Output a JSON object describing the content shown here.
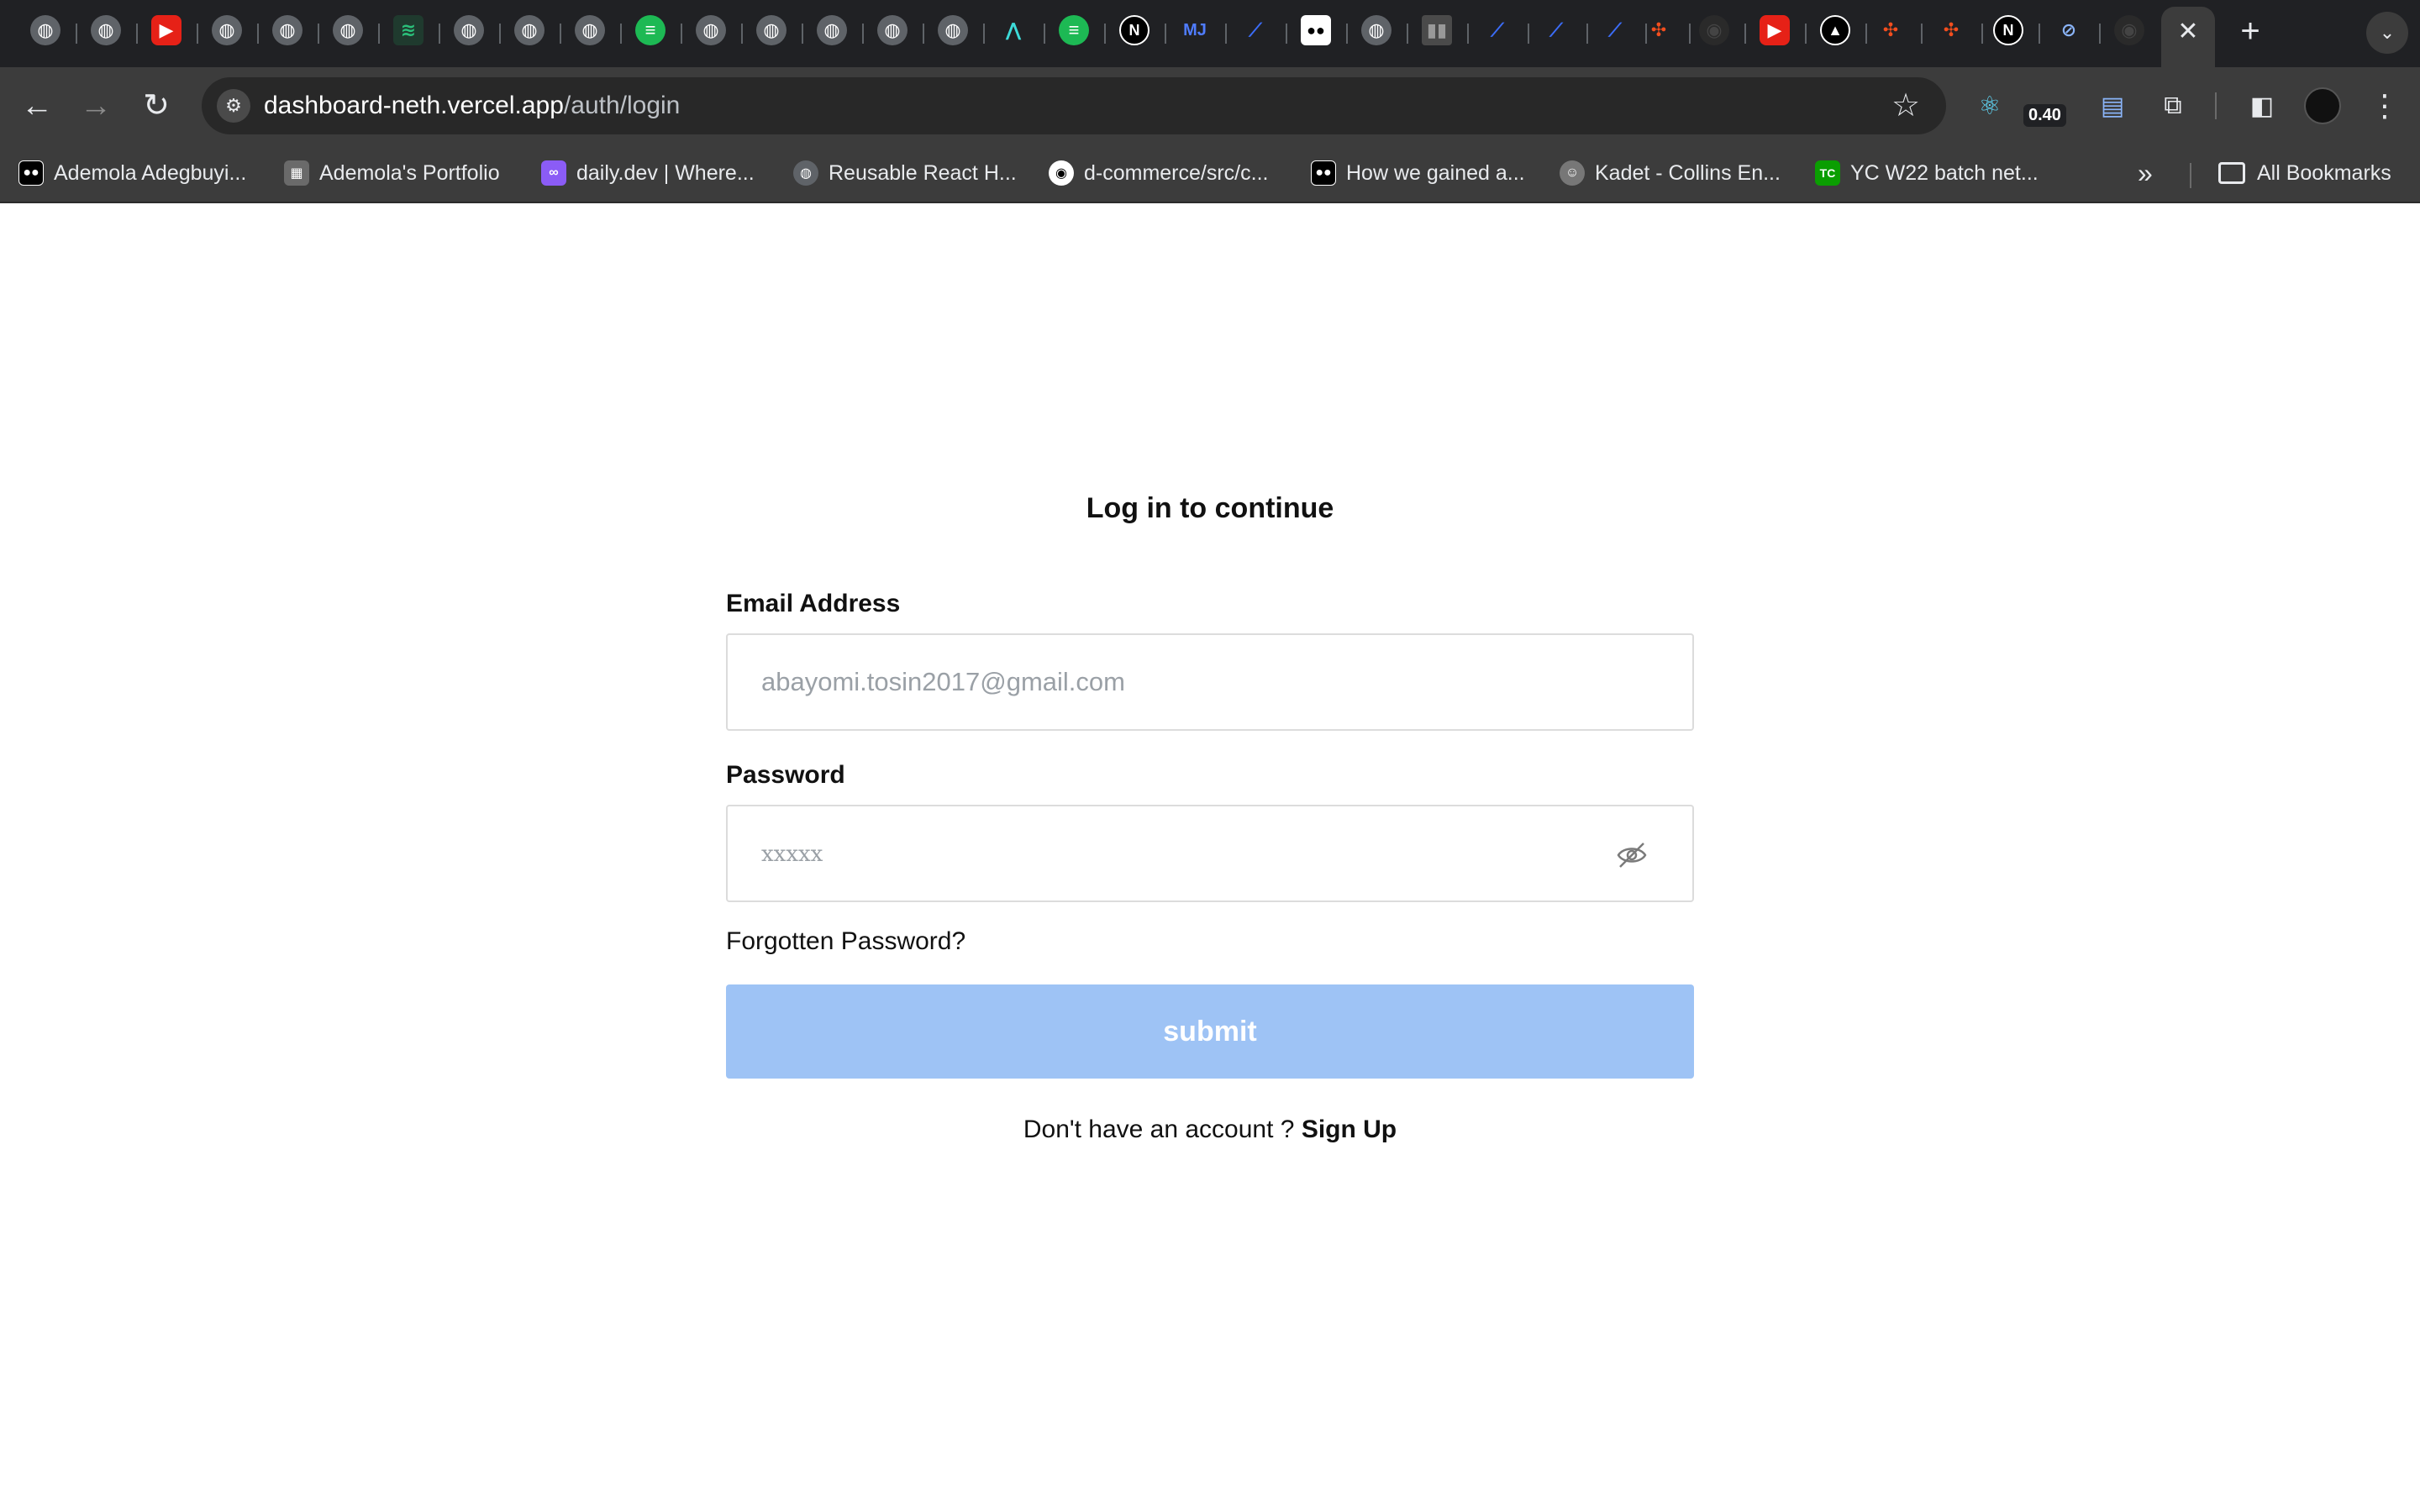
{
  "browser": {
    "url_host": "dashboard-neth.vercel.app",
    "url_path": "/auth/login",
    "extension_badge": "0.40",
    "bookmarks": [
      {
        "label": "Ademola Adegbuyi...",
        "icon": "medium-icon",
        "color": "#000000"
      },
      {
        "label": "Ademola's Portfolio",
        "icon": "portfolio-icon",
        "color": "#6a6a6a"
      },
      {
        "label": "daily.dev | Where...",
        "icon": "dailydev-icon",
        "color": "#8b5cf6"
      },
      {
        "label": "Reusable React H...",
        "icon": "globe-icon",
        "color": "#5f6368"
      },
      {
        "label": "d-commerce/src/c...",
        "icon": "github-icon",
        "color": "#000000"
      },
      {
        "label": "How we gained a...",
        "icon": "medium-icon",
        "color": "#000000"
      },
      {
        "label": "Kadet - Collins En...",
        "icon": "avatar-icon",
        "color": "#777777"
      },
      {
        "label": "YC W22 batch net...",
        "icon": "techcrunch-icon",
        "color": "#0a9e01"
      }
    ],
    "all_bookmarks_label": "All Bookmarks"
  },
  "login": {
    "title": "Log in to continue",
    "email_label": "Email Address",
    "email_value": "abayomi.tosin2017@gmail.com",
    "password_label": "Password",
    "password_value": "xxxxx",
    "forgot_label": "Forgotten Password?",
    "submit_label": "submit",
    "signup_prompt": "Don't have an account ?",
    "signup_link": "Sign Up"
  },
  "colors": {
    "submit_bg": "#9ec3f5",
    "chrome_bg": "#3c3c3c",
    "tabstrip_bg": "#202124"
  }
}
